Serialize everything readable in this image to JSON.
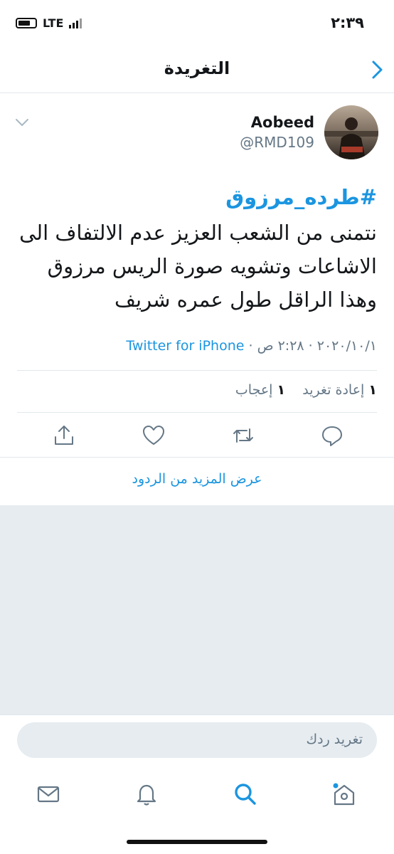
{
  "status_bar": {
    "time": "٢:٣٩",
    "network": "LTE"
  },
  "nav": {
    "title": "التغريدة"
  },
  "tweet": {
    "name": "Aobeed",
    "handle": "@RMD109",
    "hashtag": "#طرده_مرزوق",
    "text": "نتمنى من الشعب العزيز عدم الالتفاف الى الاشاعات وتشويه صورة الريس مرزوق وهذا الراقل طول عمره شريف",
    "date": "٢٠٢٠/١٠/١ · ٢:٢٨ ص · ",
    "source": "Twitter for iPhone",
    "retweets_count": "١",
    "retweets_label": "إعادة تغريد",
    "likes_count": "١",
    "likes_label": "إعجاب"
  },
  "more_replies": "عرض المزيد من الردود",
  "compose": {
    "placeholder": "تغريد ردك"
  },
  "colors": {
    "accent": "#1b95e0",
    "muted": "#657786",
    "background_grey": "#e6ecf0"
  },
  "icons": {
    "back": "chevron-right-icon",
    "caret": "chevron-down-icon",
    "reply": "reply-icon",
    "retweet": "retweet-icon",
    "like": "heart-icon",
    "share": "share-icon",
    "tabs": [
      "mail-icon",
      "bell-icon",
      "search-icon",
      "home-icon"
    ]
  }
}
